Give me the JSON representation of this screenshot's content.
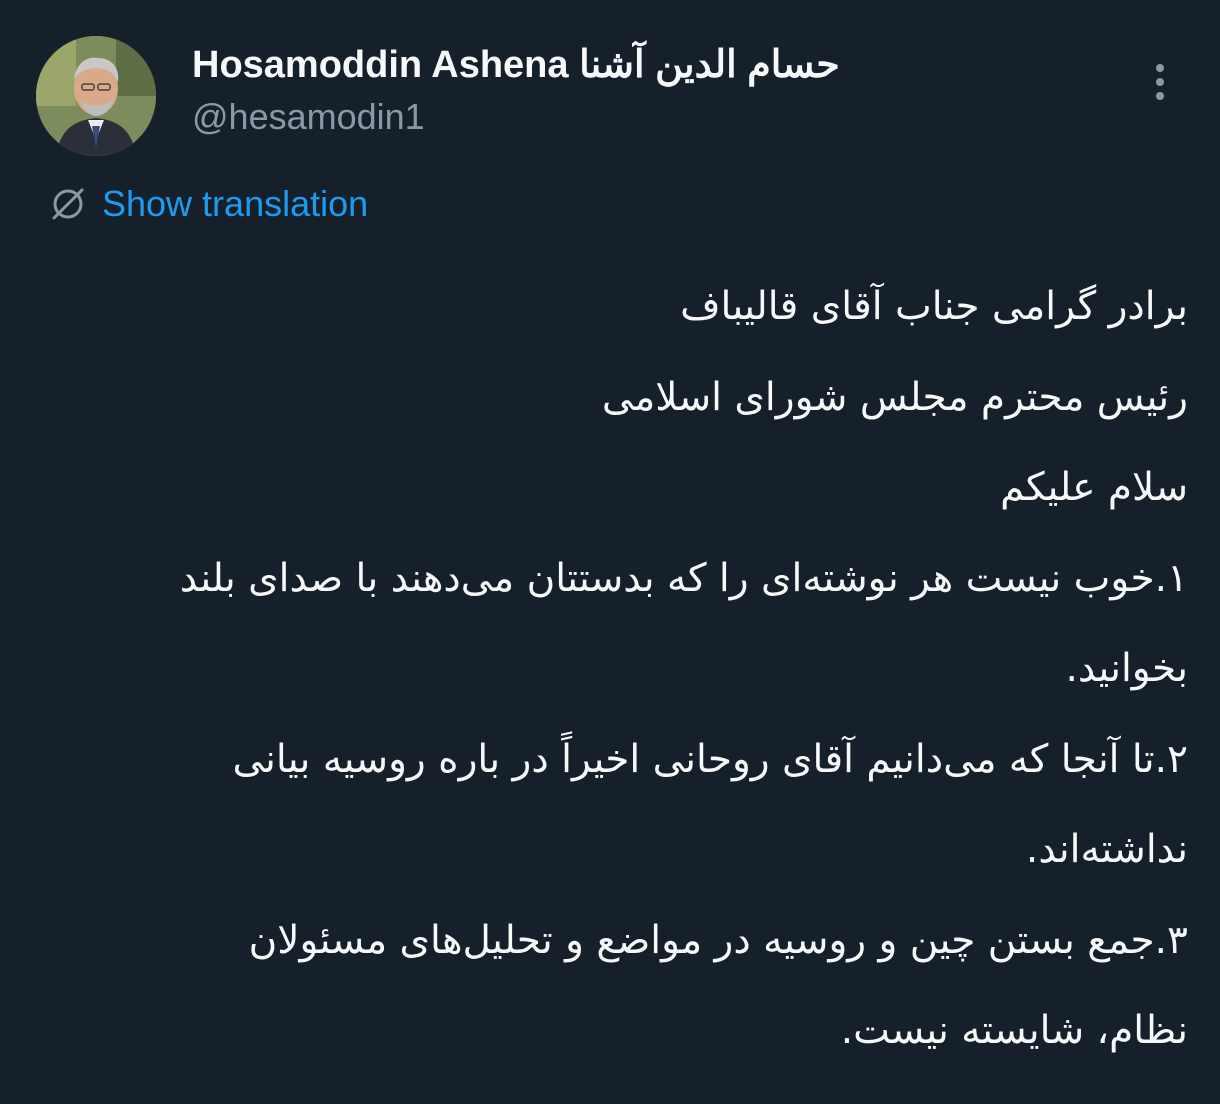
{
  "author": {
    "display_name": "Hosamoddin Ashena حسام الدين آشنا",
    "handle": "@hesamodin1"
  },
  "translate": {
    "label": "Show translation"
  },
  "tweet": {
    "lines": [
      "برادر گرامی جناب آقای قالیباف",
      "رئیس محترم مجلس شورای اسلامی",
      "سلام علیکم",
      "۱.خوب نیست هر نوشته‌ای را که بدستتان می‌دهند با صدای بلند",
      "بخوانید.",
      "۲.تا آنجا که می‌دانیم آقای روحانی اخیراً در باره روسیه بیانی",
      "نداشته‌اند.",
      "۳.جمع بستن چین و روسیه در مواضع و تحلیل‌های مسئولان",
      "نظام، شایسته نیست."
    ]
  },
  "icons": {
    "more": "more-vertical-icon",
    "translate": "globe-icon"
  },
  "colors": {
    "background": "#15202b",
    "text": "#f7f9f9",
    "secondary": "#8b98a5",
    "link": "#1d9bf0"
  }
}
